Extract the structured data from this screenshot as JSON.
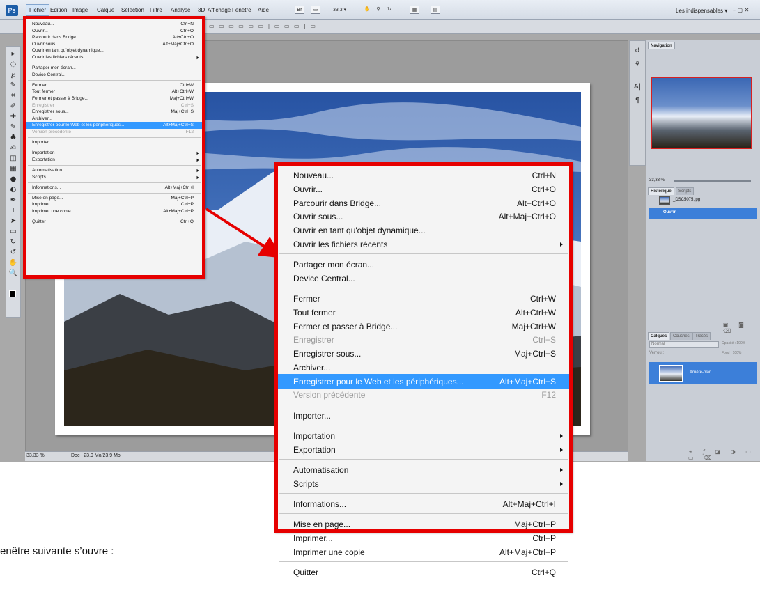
{
  "menubar": {
    "items": [
      "Fichier",
      "Edition",
      "Image",
      "Calque",
      "Sélection",
      "Filtre",
      "Analyse",
      "3D",
      "Affichage",
      "Fenêtre",
      "Aide"
    ],
    "active": "Fichier",
    "app_icon": "Ps",
    "zoom_combo": "33,3",
    "workspace": "Les indispensables"
  },
  "tools": {
    "icons": [
      "move-icon",
      "marquee-icon",
      "lasso-icon",
      "magic-wand-icon",
      "crop-icon",
      "eyedropper-icon",
      "healing-icon",
      "brush-icon",
      "stamp-icon",
      "history-brush-icon",
      "eraser-icon",
      "gradient-icon",
      "blur-icon",
      "dodge-icon",
      "pen-icon",
      "type-icon",
      "path-select-icon",
      "shape-icon",
      "3d-rotate-icon",
      "3d-orbit-icon",
      "hand-icon",
      "zoom-icon"
    ],
    "glyphs": [
      "▸",
      "◌",
      "℘",
      "✎",
      "⌗",
      "✐",
      "✚",
      "✎",
      "♣",
      "✍",
      "◫",
      "▦",
      "●",
      "◐",
      "✒",
      "T",
      "➤",
      "▭",
      "↻",
      "↺",
      "✋",
      "🔍"
    ]
  },
  "status": {
    "zoom": "33,33 %",
    "doc": "Doc : 23,9 Mo/23,9 Mo"
  },
  "panels": {
    "navigation_tab": "Navigation",
    "nav_zoom": "33,33 %",
    "history_tab": "Historique",
    "scripts_tab": "Scripts",
    "history_items": [
      "_DSC5075.jpg",
      "Ouvrir"
    ],
    "layers_tabs": [
      "Calques",
      "Couches",
      "Tracés"
    ],
    "blend_mode": "Normal",
    "opacity_label": "Opacité : 100%",
    "lock_label": "Verrou :",
    "fill_label": "Fond : 100%",
    "layer_name": "Arrière-plan"
  },
  "file_menu": [
    {
      "label": "Nouveau...",
      "shortcut": "Ctrl+N"
    },
    {
      "label": "Ouvrir...",
      "shortcut": "Ctrl+O"
    },
    {
      "label": "Parcourir dans Bridge...",
      "shortcut": "Alt+Ctrl+O"
    },
    {
      "label": "Ouvrir sous...",
      "shortcut": "Alt+Maj+Ctrl+O"
    },
    {
      "label": "Ouvrir en tant qu'objet dynamique...",
      "shortcut": ""
    },
    {
      "label": "Ouvrir les fichiers récents",
      "shortcut": "",
      "submenu": true
    },
    {
      "separator": true
    },
    {
      "label": "Partager mon écran...",
      "shortcut": ""
    },
    {
      "label": "Device Central...",
      "shortcut": ""
    },
    {
      "separator": true
    },
    {
      "label": "Fermer",
      "shortcut": "Ctrl+W"
    },
    {
      "label": "Tout fermer",
      "shortcut": "Alt+Ctrl+W"
    },
    {
      "label": "Fermer et passer à Bridge...",
      "shortcut": "Maj+Ctrl+W"
    },
    {
      "label": "Enregistrer",
      "shortcut": "Ctrl+S",
      "disabled": true
    },
    {
      "label": "Enregistrer sous...",
      "shortcut": "Maj+Ctrl+S"
    },
    {
      "label": "Archiver...",
      "shortcut": ""
    },
    {
      "label": "Enregistrer pour le Web et les périphériques...",
      "shortcut": "Alt+Maj+Ctrl+S",
      "highlighted": true
    },
    {
      "label": "Version précédente",
      "shortcut": "F12",
      "disabled": true
    },
    {
      "separator": true
    },
    {
      "label": "Importer...",
      "shortcut": ""
    },
    {
      "separator": true
    },
    {
      "label": "Importation",
      "shortcut": "",
      "submenu": true
    },
    {
      "label": "Exportation",
      "shortcut": "",
      "submenu": true
    },
    {
      "separator": true
    },
    {
      "label": "Automatisation",
      "shortcut": "",
      "submenu": true
    },
    {
      "label": "Scripts",
      "shortcut": "",
      "submenu": true
    },
    {
      "separator": true
    },
    {
      "label": "Informations...",
      "shortcut": "Alt+Maj+Ctrl+I"
    },
    {
      "separator": true
    },
    {
      "label": "Mise en page...",
      "shortcut": "Maj+Ctrl+P"
    },
    {
      "label": "Imprimer...",
      "shortcut": "Ctrl+P"
    },
    {
      "label": "Imprimer une copie",
      "shortcut": "Alt+Maj+Ctrl+P"
    },
    {
      "separator": true
    },
    {
      "label": "Quitter",
      "shortcut": "Ctrl+Q"
    }
  ],
  "caption": "enêtre suivante s’ouvre :",
  "colors": {
    "highlight": "#3399ff",
    "frame": "#e60000"
  }
}
